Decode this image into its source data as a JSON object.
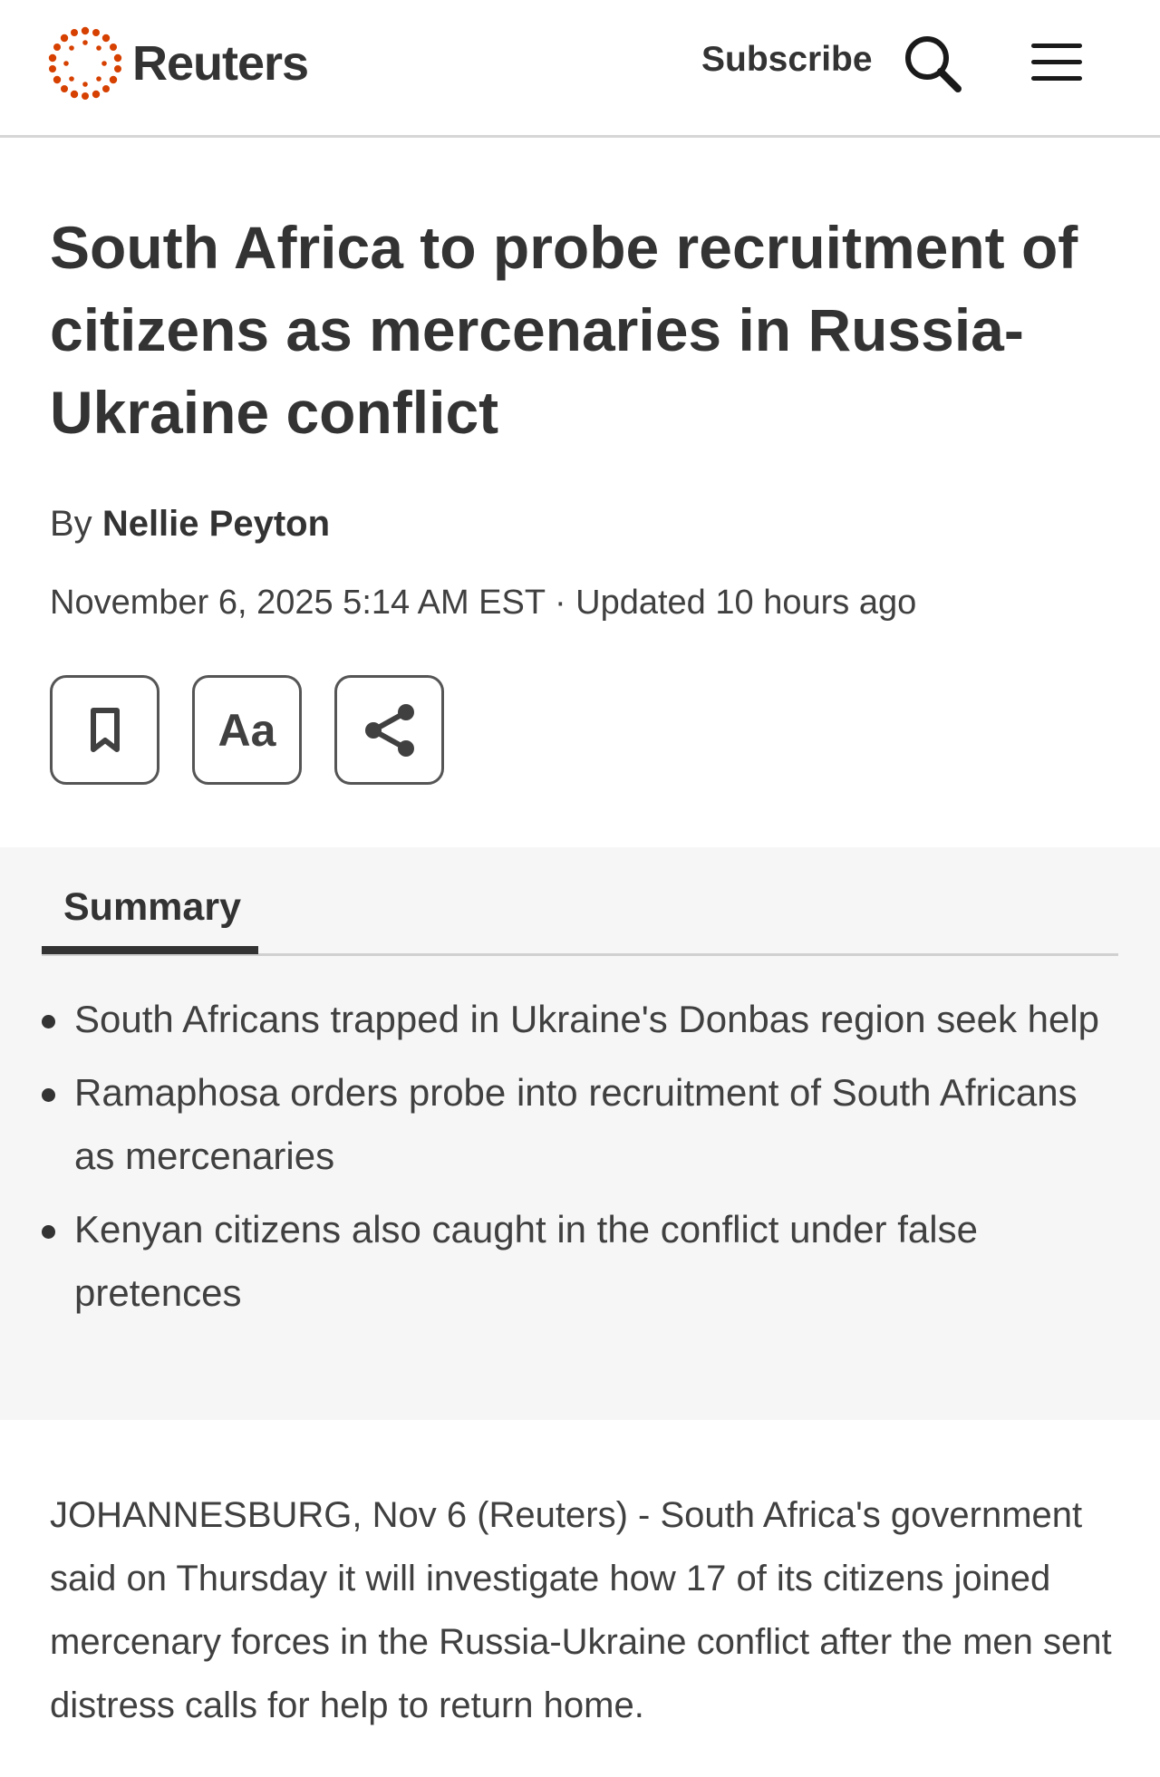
{
  "header": {
    "brand": "Reuters",
    "brand_color": "#d64000",
    "subscribe_label": "Subscribe",
    "search_icon": "search-icon",
    "menu_icon": "hamburger-menu-icon"
  },
  "article": {
    "headline": "South Africa to probe recruitment of citizens as mercenaries in Russia-Ukraine conflict",
    "byline_prefix": "By",
    "author": "Nellie Peyton",
    "dateline": "November 6, 2025 5:14 AM EST · Updated 10 hours ago",
    "actions": [
      {
        "icon": "bookmark-icon"
      },
      {
        "label": "Aa",
        "icon": "text-size-icon"
      },
      {
        "icon": "share-icon"
      }
    ]
  },
  "summary": {
    "tab_label": "Summary",
    "items": [
      "South Africans trapped in Ukraine's Donbas region seek help",
      "Ramaphosa orders probe into recruitment of South Africans as mercenaries",
      "Kenyan citizens also caught in the conflict under false pretences"
    ]
  },
  "body": {
    "paragraph": "JOHANNESBURG, Nov 6 (Reuters) - South Africa's government said on Thursday it will investigate how 17 of its citizens joined mercenary forces in the Russia-Ukraine conflict after the men sent distress calls for help to return home."
  }
}
